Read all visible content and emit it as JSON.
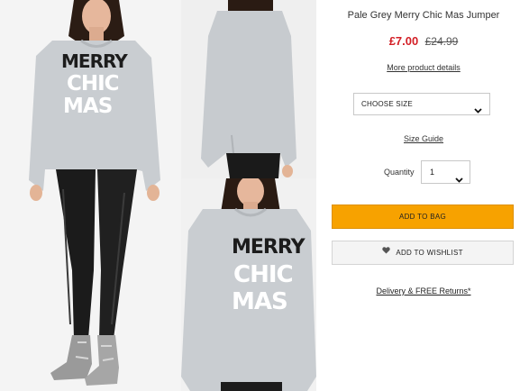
{
  "product": {
    "title": "Pale Grey Merry Chic Mas Jumper",
    "price_now": "£7.00",
    "price_was": "£24.99",
    "more_details": "More product details"
  },
  "options": {
    "size_placeholder": "CHOOSE SIZE",
    "size_guide": "Size Guide",
    "quantity_label": "Quantity",
    "quantity_value": "1"
  },
  "actions": {
    "add_to_bag": "ADD TO BAG",
    "add_to_wishlist": "ADD TO WISHLIST",
    "delivery": "Delivery & FREE Returns*"
  },
  "sweater_print": {
    "line1": "MERRY",
    "line2": "CHIC",
    "line3": "MAS"
  },
  "colors": {
    "price_now": "#d31f26",
    "add_to_bag_bg": "#f7a200",
    "wishlist_bg": "#f4f4f4",
    "jumper_grey": "#c9cdd1"
  },
  "icons": {
    "dropdown": "chevron-down-icon",
    "wishlist": "heart-icon"
  }
}
